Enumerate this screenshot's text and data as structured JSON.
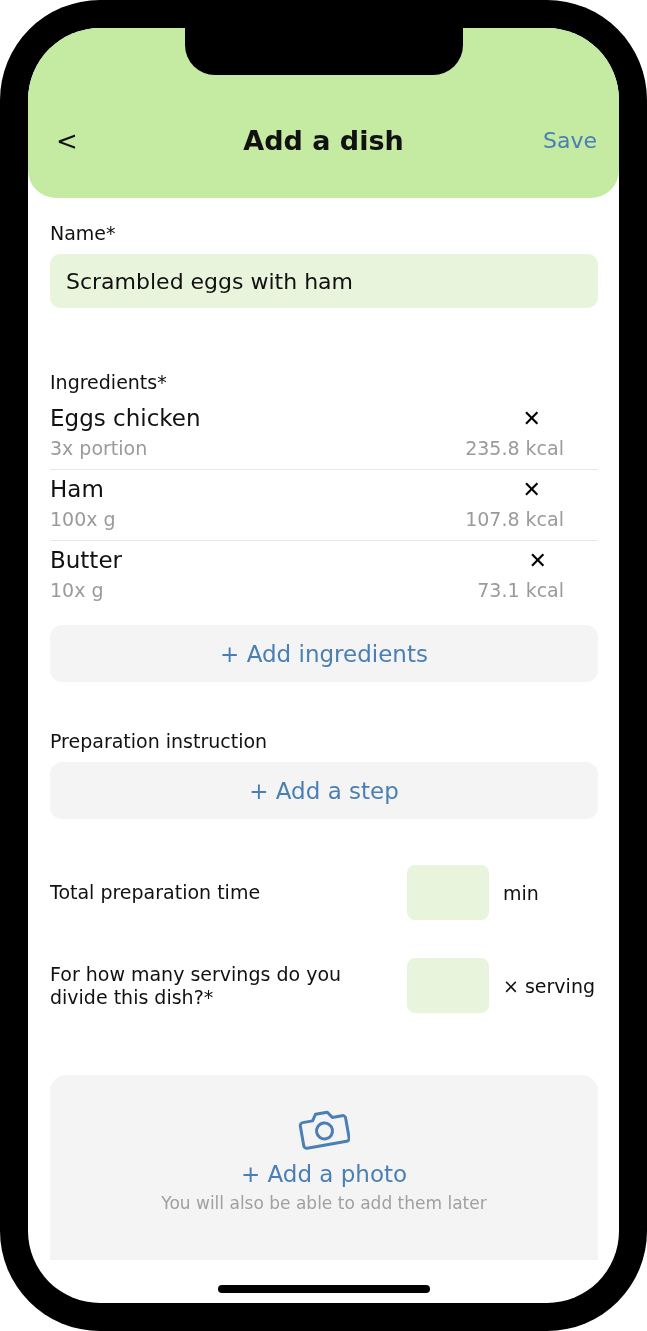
{
  "header": {
    "back": "<",
    "title": "Add a dish",
    "save": "Save"
  },
  "name_field": {
    "label": "Name*",
    "value": "Scrambled eggs with ham"
  },
  "ingredients": {
    "label": "Ingredients*",
    "items": [
      {
        "name": "Eggs chicken",
        "amount": "3x portion",
        "kcal": "235.8 kcal",
        "remove": "✕"
      },
      {
        "name": "Ham",
        "amount": "100x g",
        "kcal": "107.8 kcal",
        "remove": "✕"
      },
      {
        "name": "Butter",
        "amount": "10x g",
        "kcal": "73.1 kcal",
        "remove": "✕"
      }
    ],
    "add_button": "+ Add ingredients"
  },
  "preparation": {
    "label": "Preparation instruction",
    "add_button": "+ Add a step"
  },
  "time_field": {
    "label": "Total preparation time",
    "unit": "min"
  },
  "servings_field": {
    "label": "For how many servings do you divide this dish?*",
    "unit": "× serving"
  },
  "photo": {
    "add_button": "+ Add a photo",
    "hint": "You will also be able to add them later"
  }
}
